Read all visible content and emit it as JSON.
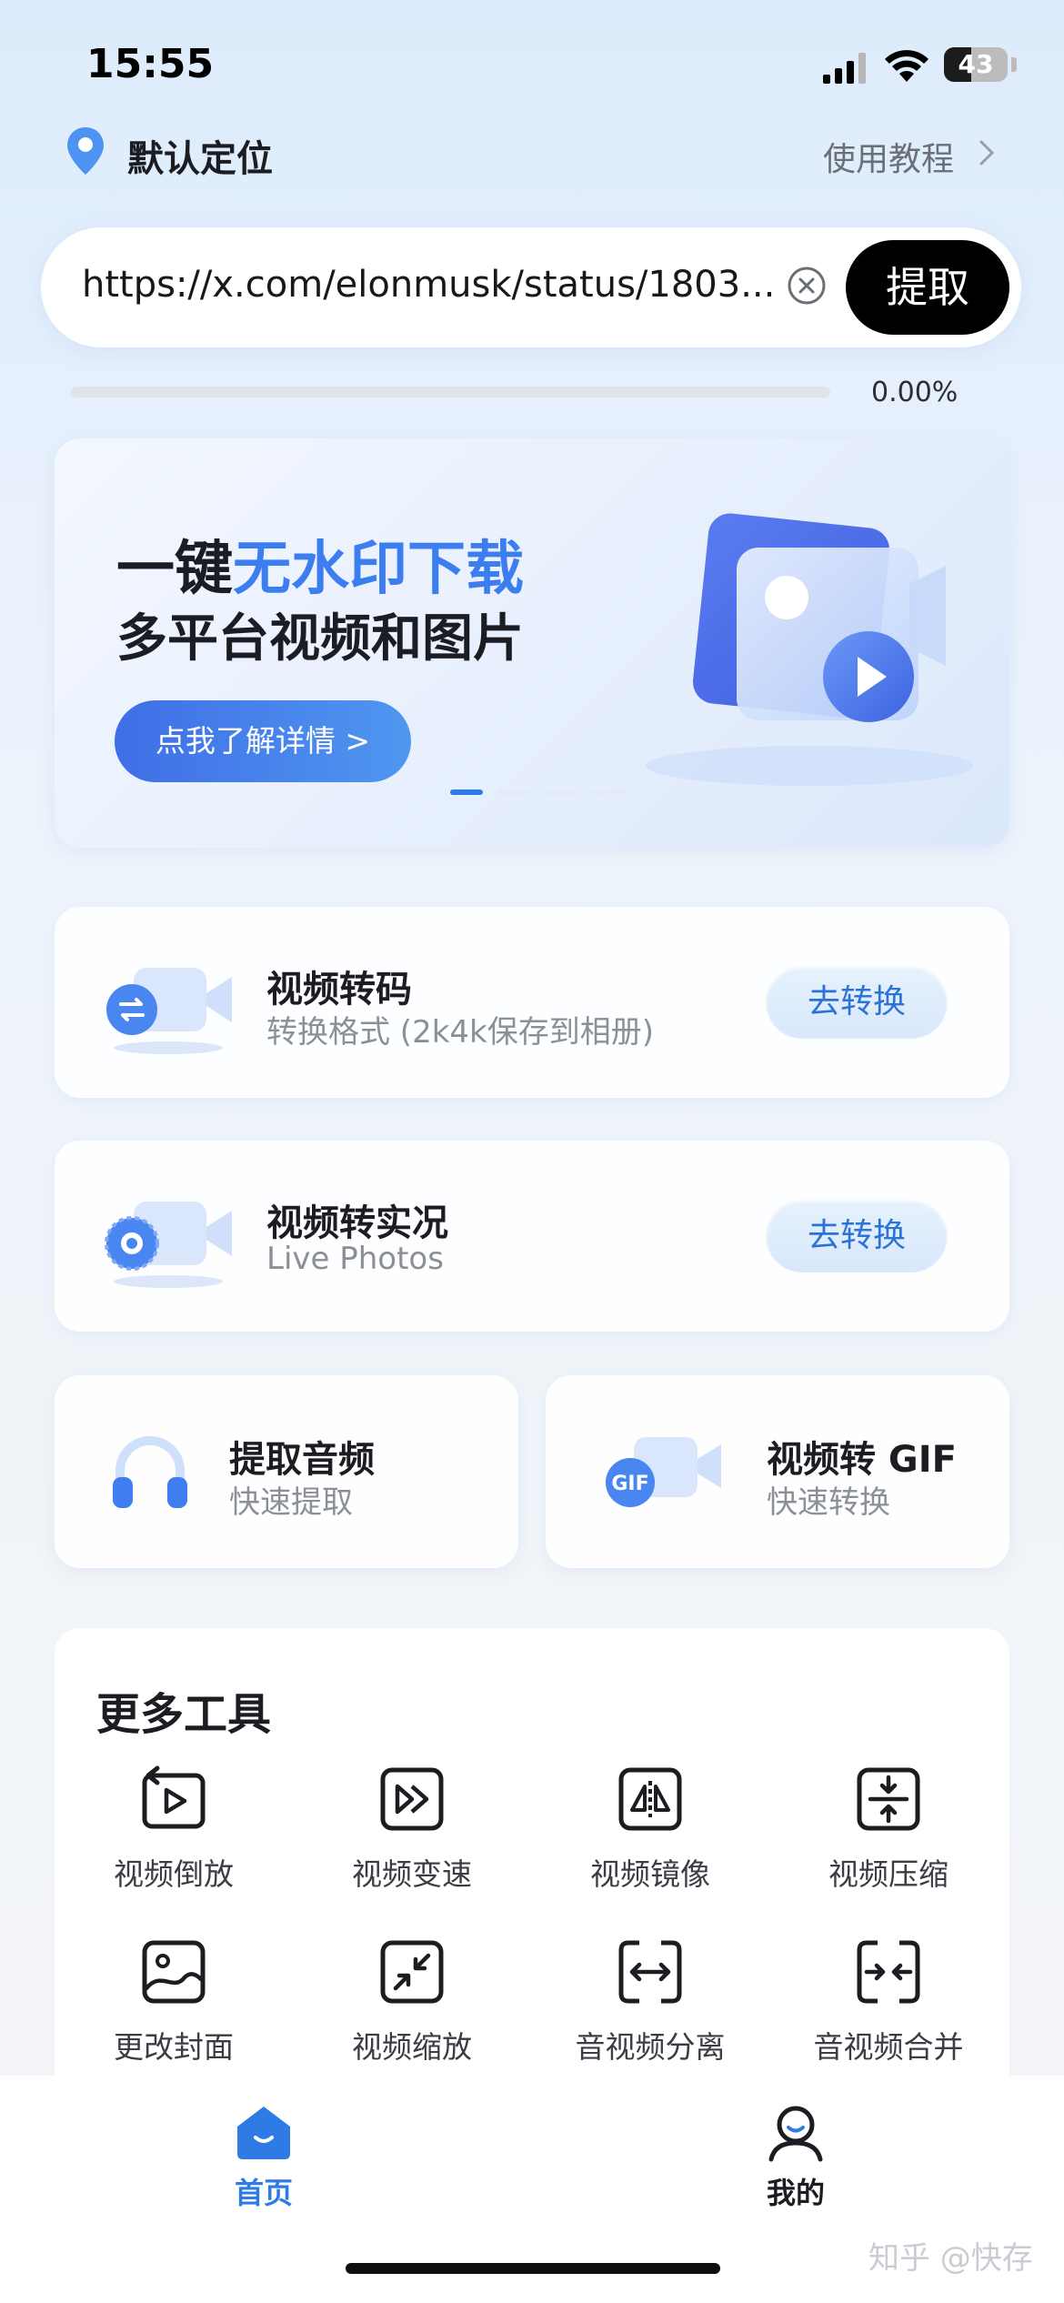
{
  "status_bar": {
    "time": "15:55",
    "battery": "43",
    "battery_level": 0.43
  },
  "location": {
    "label": "默认定位",
    "tutorial_label": "使用教程"
  },
  "url_input": {
    "value": "https://x.com/elonmusk/status/1803...",
    "extract_label": "提取"
  },
  "progress": {
    "value": 0.0,
    "text": "0.00%"
  },
  "banner": {
    "title_prefix": "一键",
    "title_highlight": "无水印下载",
    "subtitle": "多平台视频和图片",
    "button_label": "点我了解详情 >",
    "page_count": 4,
    "active_page": 0
  },
  "feature_cards": [
    {
      "title": "视频转码",
      "subtitle": "转换格式 (2k4k保存到相册)",
      "button": "去转换"
    },
    {
      "title": "视频转实况",
      "subtitle": "Live Photos",
      "button": "去转换"
    }
  ],
  "mini_cards": [
    {
      "title": "提取音频",
      "subtitle": "快速提取"
    },
    {
      "title": "视频转 GIF",
      "subtitle": "快速转换",
      "badge": "GIF"
    }
  ],
  "more_tools": {
    "title": "更多工具",
    "items": [
      {
        "label": "视频倒放",
        "icon": "video-reverse-icon"
      },
      {
        "label": "视频变速",
        "icon": "video-speed-icon"
      },
      {
        "label": "视频镜像",
        "icon": "video-mirror-icon"
      },
      {
        "label": "视频压缩",
        "icon": "video-compress-icon"
      },
      {
        "label": "更改封面",
        "icon": "cover-image-icon"
      },
      {
        "label": "视频缩放",
        "icon": "video-zoom-icon"
      },
      {
        "label": "音视频分离",
        "icon": "av-split-icon"
      },
      {
        "label": "音视频合并",
        "icon": "av-merge-icon"
      }
    ]
  },
  "tabbar": {
    "home_label": "首页",
    "mine_label": "我的"
  },
  "watermark": "知乎 @快存",
  "colors": {
    "accent": "#3c7ef0",
    "tab_active": "#2f7be6",
    "button_dark": "#000000"
  }
}
